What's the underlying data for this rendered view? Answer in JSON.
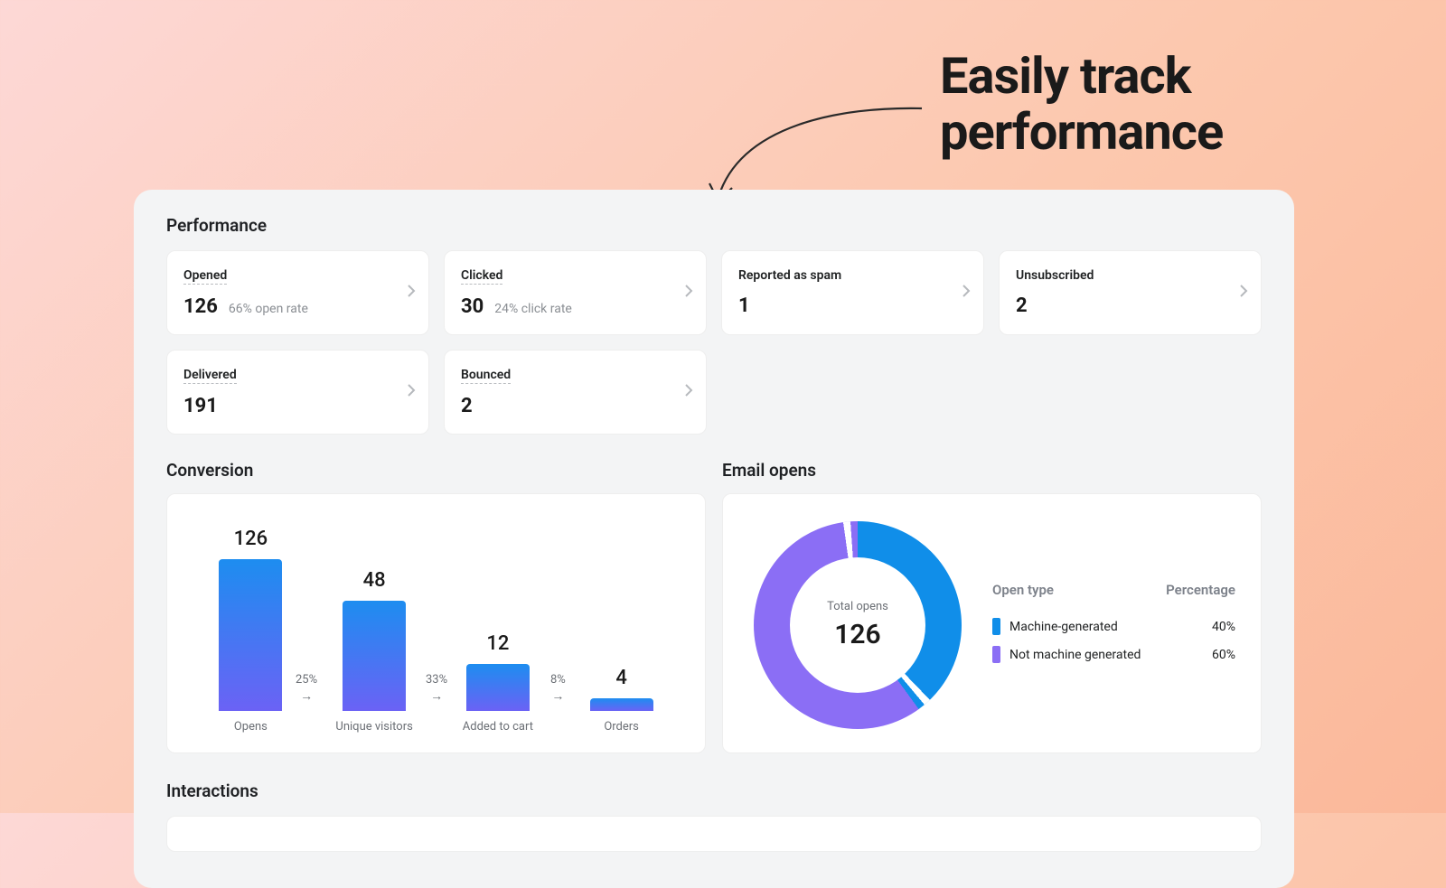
{
  "hero": {
    "title_line1": "Easily track",
    "title_line2": "performance"
  },
  "sections": {
    "performance": "Performance",
    "conversion": "Conversion",
    "email_opens": "Email opens",
    "interactions": "Interactions"
  },
  "cards": {
    "opened": {
      "label": "Opened",
      "value": "126",
      "sub": "66% open rate"
    },
    "clicked": {
      "label": "Clicked",
      "value": "30",
      "sub": "24% click rate"
    },
    "spam": {
      "label": "Reported as spam",
      "value": "1"
    },
    "unsub": {
      "label": "Unsubscribed",
      "value": "2"
    },
    "delivered": {
      "label": "Delivered",
      "value": "191"
    },
    "bounced": {
      "label": "Bounced",
      "value": "2"
    }
  },
  "chart_data": [
    {
      "type": "bar",
      "title": "Conversion",
      "categories": [
        "Opens",
        "Unique visitors",
        "Added to cart",
        "Orders"
      ],
      "values": [
        126,
        48,
        12,
        4
      ],
      "step_rates": [
        "25%",
        "33%",
        "8%"
      ],
      "ylim": [
        0,
        130
      ]
    },
    {
      "type": "pie",
      "title": "Email opens",
      "center_label": "Total opens",
      "center_value": 126,
      "legend_headers": [
        "Open type",
        "Percentage"
      ],
      "series": [
        {
          "name": "Machine-generated",
          "value": 40,
          "color": "#108ee9"
        },
        {
          "name": "Not machine generated",
          "value": 60,
          "color": "#8b6ef5"
        }
      ]
    }
  ],
  "colors": {
    "bar_top": "#1d8df0",
    "bar_bottom": "#6b62f5"
  }
}
